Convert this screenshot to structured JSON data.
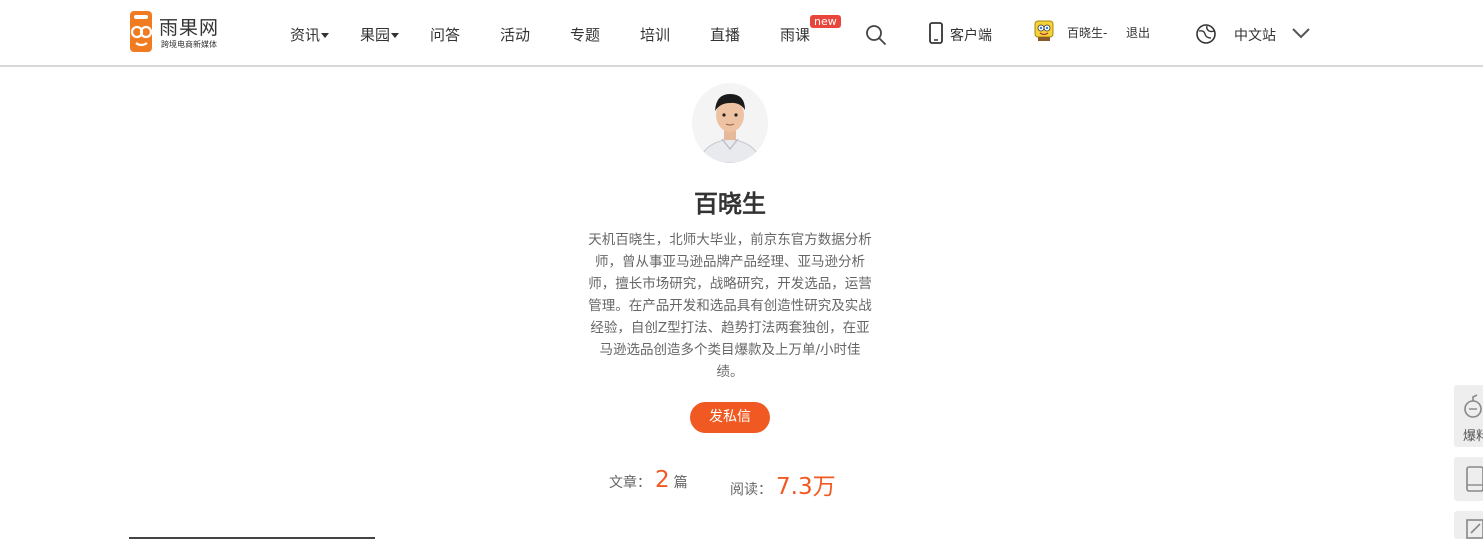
{
  "header": {
    "logo": {
      "name": "雨果网",
      "tagline": "跨境电商新媒体",
      "brand_color": "#f07b21"
    },
    "nav": [
      {
        "label": "资讯",
        "has_dropdown": true
      },
      {
        "label": "果园",
        "has_dropdown": true
      },
      {
        "label": "问答",
        "has_dropdown": false
      },
      {
        "label": "活动",
        "has_dropdown": false
      },
      {
        "label": "专题",
        "has_dropdown": false
      },
      {
        "label": "培训",
        "has_dropdown": false
      },
      {
        "label": "直播",
        "has_dropdown": false
      },
      {
        "label": "雨课",
        "has_dropdown": false,
        "badge": "new"
      }
    ],
    "search_icon": "search-icon",
    "client_label": "客户端",
    "user_name": "百晓生-",
    "logout_label": "退出",
    "language_label": "中文站"
  },
  "profile": {
    "name": "百晓生",
    "bio": "天机百晓生，北师大毕业，前京东官方数据分析师，曾从事亚马逊品牌产品经理、亚马逊分析师，擅长市场研究，战略研究，开发选品，运营管理。在产品开发和选品具有创造性研究及实战经验，自创Z型打法、趋势打法两套独创，在亚马逊选品创造多个类目爆款及上万单/小时佳绩。",
    "message_button": "发私信",
    "stats": {
      "articles_label": "文章：",
      "articles_value": "2",
      "articles_unit": "篇",
      "reads_label": "阅读：",
      "reads_value": "7.3万"
    }
  },
  "side_tools": [
    {
      "label": "爆料",
      "icon": "bomb-icon"
    },
    {
      "icon": "tablet-icon"
    },
    {
      "icon": "edit-icon"
    }
  ],
  "colors": {
    "accent": "#f05a22",
    "badge": "#e8453c"
  }
}
